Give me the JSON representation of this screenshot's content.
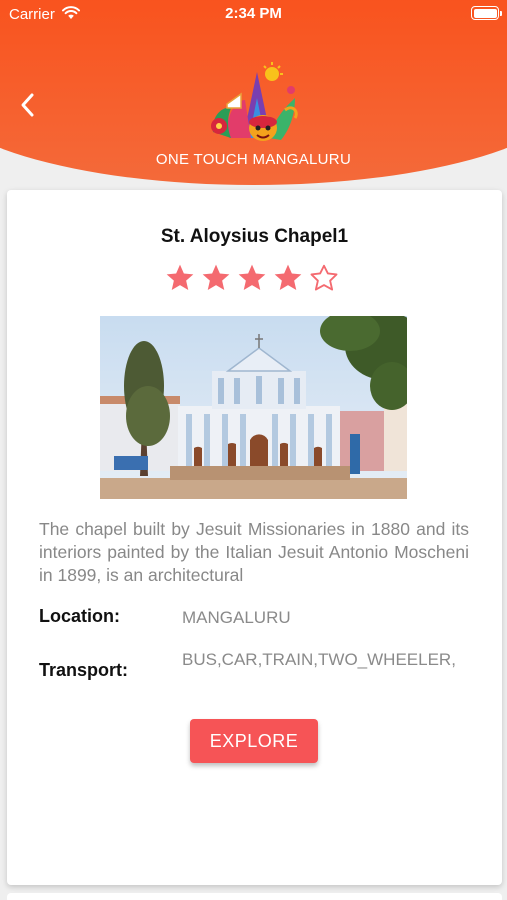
{
  "status_bar": {
    "carrier": "Carrier",
    "time": "2:34 PM",
    "wifi_icon": "wifi-icon",
    "battery_icon": "battery-icon"
  },
  "header": {
    "back_icon": "chevron-left-icon",
    "brand": "ONE TOUCH MANGALURU",
    "gradient_colors": [
      "#ff3b20",
      "#f46a3a"
    ]
  },
  "place": {
    "title": "St. Aloysius Chapel1",
    "rating": 4,
    "rating_max": 5,
    "star_color": "#f46a70",
    "description": "The chapel built by Jesuit Missionaries in 1880 and its interiors painted by the Italian Jesuit Antonio Moscheni in 1899, is an architectural",
    "location_label": "Location:",
    "location_value": "MANGALURU",
    "transport_label": "Transport:",
    "transport_value": "BUS,CAR,TRAIN,TWO_WHEELER,"
  },
  "actions": {
    "explore_label": "EXPLORE",
    "explore_color": "#f65456"
  }
}
